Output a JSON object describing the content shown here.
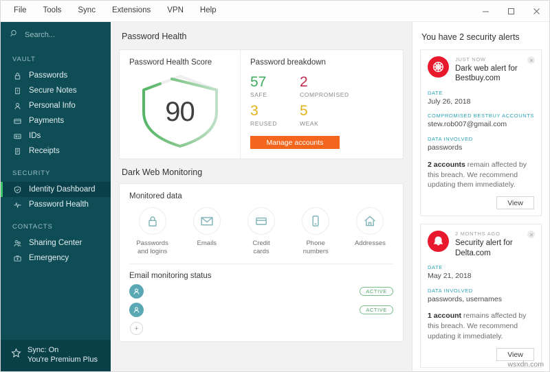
{
  "window": {
    "menu": [
      "File",
      "Tools",
      "Sync",
      "Extensions",
      "VPN",
      "Help"
    ],
    "controls": {
      "minimize": "minimize-icon",
      "maximize": "maximize-icon",
      "close": "close-icon"
    }
  },
  "sidebar": {
    "search_placeholder": "Search...",
    "groups": [
      {
        "heading": "VAULT",
        "items": [
          {
            "label": "Passwords",
            "icon": "lock-icon"
          },
          {
            "label": "Secure Notes",
            "icon": "note-icon"
          },
          {
            "label": "Personal Info",
            "icon": "person-icon"
          },
          {
            "label": "Payments",
            "icon": "credit-card-icon"
          },
          {
            "label": "IDs",
            "icon": "id-card-icon"
          },
          {
            "label": "Receipts",
            "icon": "receipt-icon"
          }
        ]
      },
      {
        "heading": "SECURITY",
        "items": [
          {
            "label": "Identity Dashboard",
            "icon": "shield-icon",
            "active": true
          },
          {
            "label": "Password Health",
            "icon": "pulse-icon"
          }
        ]
      },
      {
        "heading": "CONTACTS",
        "items": [
          {
            "label": "Sharing Center",
            "icon": "share-icon"
          },
          {
            "label": "Emergency",
            "icon": "emergency-kit-icon"
          }
        ]
      }
    ],
    "footer": {
      "sync": "Sync: On",
      "plan": "You're Premium Plus",
      "icon": "star-icon"
    }
  },
  "main": {
    "page_title": "Password Health",
    "score_card": {
      "title": "Password Health Score",
      "score": "90",
      "gauge_color": "#5cb85c",
      "gauge_track_color": "#cfe8d5"
    },
    "breakdown": {
      "title": "Password breakdown",
      "stats": [
        {
          "value": "57",
          "label": "SAFE",
          "color": "#43ab5e"
        },
        {
          "value": "2",
          "label": "COMPROMISED",
          "color": "#c42a4d"
        },
        {
          "value": "3",
          "label": "REUSED",
          "color": "#e0b317"
        },
        {
          "value": "5",
          "label": "WEAK",
          "color": "#e0b317"
        }
      ],
      "button": "Manage accounts",
      "button_color": "#f4661e"
    },
    "dark_web": {
      "section_title": "Dark Web Monitoring",
      "monitored_title": "Monitored data",
      "items": [
        {
          "label": "Passwords\nand logins",
          "icon": "lock-icon"
        },
        {
          "label": "Emails",
          "icon": "envelope-icon"
        },
        {
          "label": "Credit\ncards",
          "icon": "credit-card-icon"
        },
        {
          "label": "Phone\nnumbers",
          "icon": "phone-icon"
        },
        {
          "label": "Addresses",
          "icon": "home-icon"
        }
      ],
      "email_title": "Email monitoring status",
      "emails": [
        {
          "status": "ACTIVE",
          "icon": "avatar-icon"
        },
        {
          "status": "ACTIVE",
          "icon": "avatar-icon"
        }
      ],
      "add_label": "+"
    }
  },
  "alerts": {
    "title": "You have 2 security alerts",
    "items": [
      {
        "when": "JUST NOW",
        "name": "Dark web alert for Bestbuy.com",
        "icon": "spider-web-icon",
        "fields": [
          {
            "label": "DATE",
            "value": "July 26, 2018"
          },
          {
            "label": "COMPROMISED BESTBUY ACCOUNTS",
            "value": "stew.rob007@gmail.com"
          },
          {
            "label": "DATA INVOLVED",
            "value": "passwords"
          }
        ],
        "message_bold": "2 accounts",
        "message_rest": " remain affected by this breach. We recommend updating them immediately.",
        "button": "View"
      },
      {
        "when": "2 MONTHS AGO",
        "name": "Security alert for Delta.com",
        "icon": "bell-icon",
        "fields": [
          {
            "label": "DATE",
            "value": "May 21, 2018"
          },
          {
            "label": "DATA INVOLVED",
            "value": "passwords, usernames"
          }
        ],
        "message_bold": "1 account",
        "message_rest": " remains affected by this breach. We recommend updating it immediately.",
        "button": "View"
      }
    ]
  },
  "watermark": "wsxdn.com"
}
